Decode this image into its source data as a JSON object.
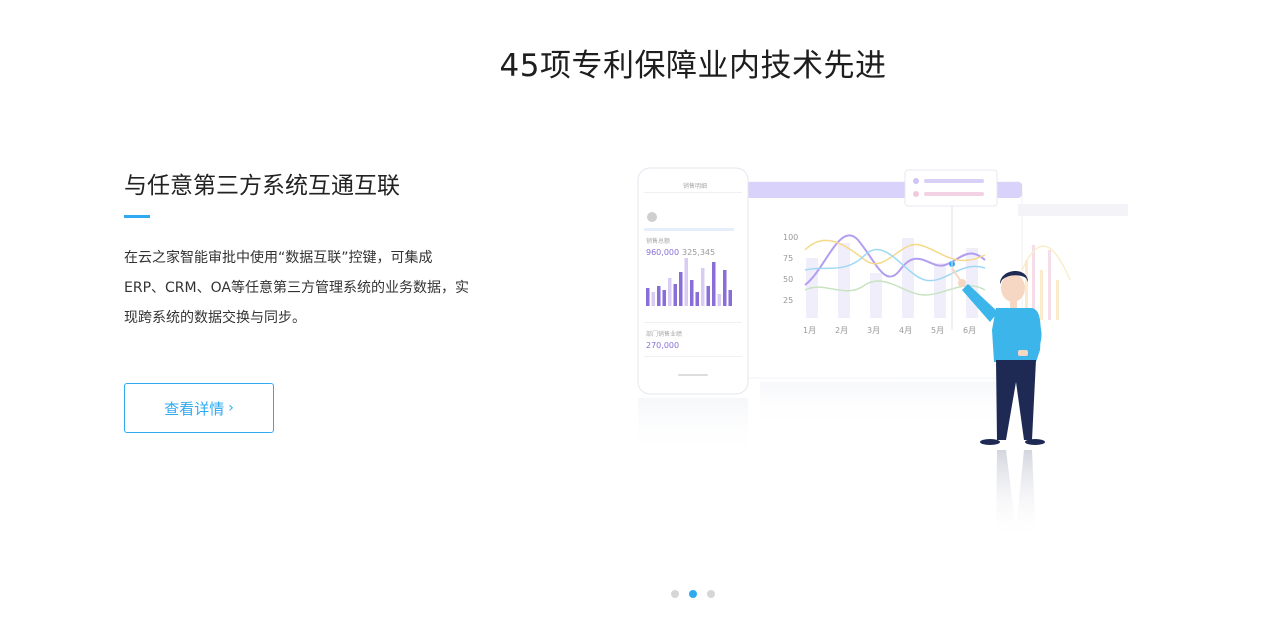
{
  "section": {
    "title": "45项专利保障业内技术先进"
  },
  "feature": {
    "title": "与任意第三方系统互通互联",
    "description": "在云之家智能审批中使用“数据互联”控键，可集成ERP、CRM、OA等任意第三方管理系统的业务数据，实现跨系统的数据交换与同步。",
    "button_label": "查看详情",
    "button_chevron": "›"
  },
  "carousel": {
    "dots": [
      false,
      true,
      false
    ]
  },
  "colors": {
    "accent": "#2eaaf0",
    "bar_primary": "#8a6ed8",
    "bar_light": "#d8ccf5"
  },
  "illustration": {
    "phone": {
      "header_title": "销售明细",
      "metric_a": "960,000",
      "metric_b": "325,345",
      "metric_c": "270,000",
      "section_label_a": "销售总额",
      "section_label_b": "部门销售业绩"
    },
    "chart": {
      "y_ticks": [
        "100",
        "75",
        "50",
        "25"
      ],
      "x_ticks": [
        "1月",
        "2月",
        "3月",
        "4月",
        "5月",
        "6月"
      ]
    }
  }
}
